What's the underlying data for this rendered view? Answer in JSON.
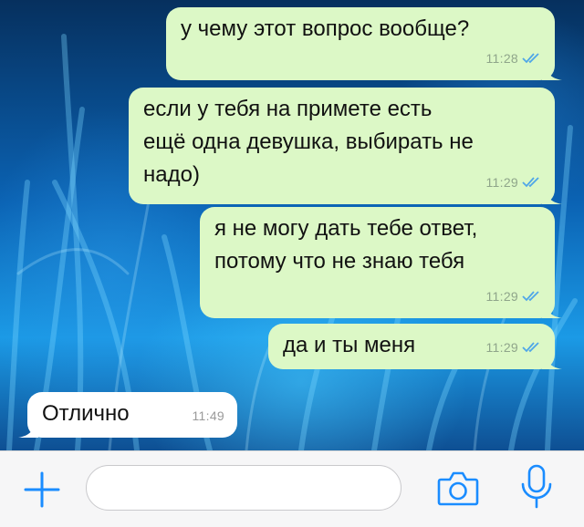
{
  "messages": [
    {
      "direction": "outgoing",
      "text": "у чему этот вопрос вообще?",
      "time": "11:28",
      "read": true
    },
    {
      "direction": "outgoing",
      "text": "если у тебя на примете есть\nещё одна девушка, выбирать не\nнадо)",
      "time": "11:29",
      "read": true
    },
    {
      "direction": "outgoing",
      "text": "я не могу дать тебе ответ,\nпотому что не знаю тебя",
      "time": "11:29",
      "read": true
    },
    {
      "direction": "outgoing",
      "text": "да и ты меня",
      "time": "11:29",
      "read": true
    },
    {
      "direction": "incoming",
      "text": "Отлично",
      "time": "11:49"
    }
  ],
  "input_bar": {
    "message_placeholder": "",
    "icons": [
      "plus-icon",
      "camera-icon",
      "microphone-icon"
    ]
  },
  "colors": {
    "outgoing_bubble": "#dcf8c6",
    "incoming_bubble": "#ffffff",
    "accent": "#1a8cff",
    "read_ticks": "#4fa6e8"
  }
}
